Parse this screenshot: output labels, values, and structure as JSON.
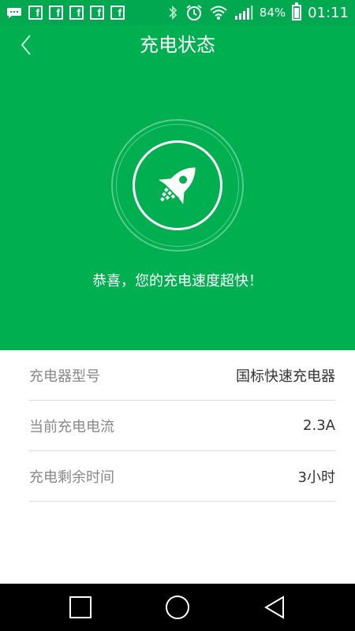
{
  "status_bar": {
    "notification_icons": [
      "message-icon",
      "facebook-icon",
      "facebook-icon",
      "facebook-icon",
      "facebook-icon",
      "facebook-icon"
    ],
    "facebook_glyph": "f",
    "battery_percent": "84%",
    "battery_level": 0.84,
    "time": "01:11"
  },
  "header": {
    "title": "充电状态",
    "back_icon": "chevron-left-icon"
  },
  "hero": {
    "icon": "rocket-icon",
    "message": "恭喜，您的充电速度超快！"
  },
  "info_rows": [
    {
      "label": "充电器型号",
      "value": "国标快速充电器"
    },
    {
      "label": "当前充电电流",
      "value": "2.3A"
    },
    {
      "label": "充电剩余时间",
      "value": "3小时"
    }
  ],
  "nav_bar": {
    "buttons": [
      "recent-apps-icon",
      "home-icon",
      "back-icon"
    ]
  },
  "colors": {
    "brand_green": "#00b050",
    "status_green": "#00a94f"
  }
}
